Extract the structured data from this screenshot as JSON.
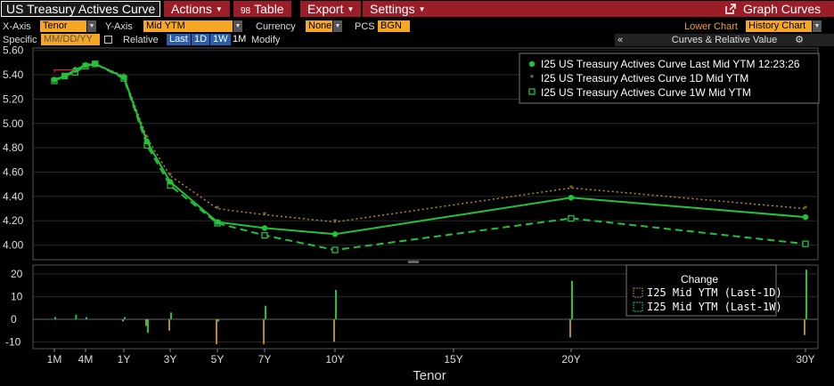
{
  "toolbar": {
    "title": "US Treasury Actives Curve",
    "actions_label": "Actions",
    "table_icon_text": "98",
    "table_label": "Table",
    "export_label": "Export",
    "settings_label": "Settings",
    "graph_curves_label": "Graph Curves"
  },
  "controls": {
    "xaxis_label": "X-Axis",
    "xaxis_value": "Tenor",
    "yaxis_label": "Y-Axis",
    "yaxis_value": "Mid YTM",
    "currency_label": "Currency",
    "currency_value": "None",
    "pcs_label": "PCS",
    "pcs_value": "BGN",
    "lower_chart_label": "Lower Chart",
    "lower_chart_value": "History Chart",
    "specific_label": "Specific",
    "date_placeholder": "MM/DD/YY",
    "relative_label": "Relative",
    "rel_last": "Last",
    "rel_1d": "1D",
    "rel_1w": "1W",
    "rel_1m": "1M",
    "modify_label": "Modify",
    "panel_collapse": "«",
    "curves_relative_label": "Curves & Relative Value"
  },
  "colors": {
    "accent": "#f5a623",
    "menu_red": "#9a1d27",
    "curve_last": "#22c33a",
    "curve_1d": "#b38a28",
    "curve_1w": "#22c33a",
    "bar_1d": "#b38a28",
    "bar_1w": "#22c33a"
  },
  "chart_data": {
    "type": "line",
    "xlabel": "Tenor",
    "x_ticks": [
      "1M",
      "4M",
      "1Y",
      "3Y",
      "5Y",
      "7Y",
      "10Y",
      "15Y",
      "20Y",
      "30Y"
    ],
    "y_ticks": [
      "5.60",
      "5.40",
      "5.20",
      "5.00",
      "4.80",
      "4.60",
      "4.40",
      "4.20",
      "4.00"
    ],
    "ylim": [
      3.88,
      5.62
    ],
    "grid": true,
    "legend_position": "top-right",
    "legend": [
      "I25 US Treasury Actives Curve Last Mid YTM 12:23:26",
      "I25 US Treasury Actives Curve 1D Mid YTM",
      "I25 US Treasury Actives Curve 1W Mid YTM"
    ],
    "tenors": [
      "1M",
      "2M",
      "3M",
      "4M",
      "6M",
      "1Y",
      "2Y",
      "3Y",
      "5Y",
      "7Y",
      "10Y",
      "20Y",
      "30Y"
    ],
    "series": [
      {
        "name": "Last",
        "values": [
          5.36,
          5.39,
          5.44,
          5.48,
          5.49,
          5.38,
          4.85,
          4.52,
          4.19,
          4.14,
          4.09,
          4.39,
          4.23
        ]
      },
      {
        "name": "1D",
        "values": [
          5.36,
          5.39,
          5.44,
          5.48,
          5.49,
          5.39,
          4.88,
          4.57,
          4.3,
          4.25,
          4.19,
          4.47,
          4.3
        ]
      },
      {
        "name": "1W",
        "values": [
          5.35,
          5.39,
          5.42,
          5.47,
          5.49,
          5.37,
          4.82,
          4.49,
          4.18,
          4.08,
          3.96,
          4.22,
          4.01
        ]
      }
    ],
    "lower": {
      "title": "Change",
      "y_ticks": [
        "20",
        "10",
        "0",
        "-10"
      ],
      "ylim": [
        -13,
        24
      ],
      "legend": [
        "I25 Mid YTM (Last-1D)",
        "I25 Mid YTM (Last-1W)"
      ],
      "last_1d": [
        0,
        0,
        0,
        0,
        0,
        -1,
        -3,
        -5,
        -11,
        -11,
        -10,
        -8,
        -7
      ],
      "last_1w": [
        1,
        0,
        2,
        1,
        0,
        1,
        -6,
        3,
        -1,
        6,
        13,
        17,
        22
      ]
    }
  }
}
